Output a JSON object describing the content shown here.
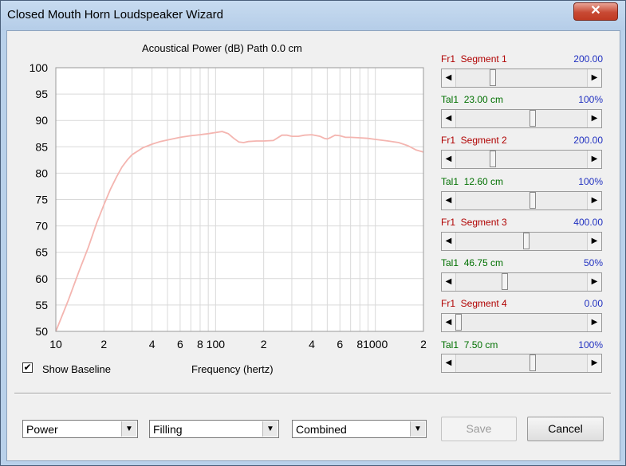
{
  "window": {
    "title": "Closed Mouth Horn Loudspeaker Wizard",
    "close_glyph": "✕"
  },
  "plot": {
    "title": "Acoustical Power (dB)   Path 0.0 cm",
    "xlabel": "Frequency (hertz)"
  },
  "chart_data": {
    "type": "line",
    "title": "Acoustical Power (dB)   Path 0.0 cm",
    "xlabel": "Frequency (hertz)",
    "ylabel": "",
    "x_scale": "log",
    "xlim": [
      10,
      2000
    ],
    "ylim": [
      50,
      100
    ],
    "grid": true,
    "y_ticks": [
      100,
      95,
      90,
      85,
      80,
      75,
      70,
      65,
      60,
      55,
      50
    ],
    "x_tick_labels": [
      "10",
      "2",
      "4",
      "6",
      "8",
      "100",
      "2",
      "4",
      "6",
      "8",
      "1000",
      "2"
    ],
    "series": [
      {
        "color": "#f4b5b0",
        "x": [
          10,
          12,
          14,
          16,
          18,
          20,
          22,
          24,
          26,
          28,
          30,
          35,
          40,
          45,
          50,
          60,
          70,
          80,
          90,
          100,
          110,
          120,
          130,
          140,
          150,
          160,
          180,
          200,
          230,
          260,
          280,
          300,
          330,
          360,
          400,
          450,
          480,
          500,
          520,
          560,
          600,
          650,
          700,
          800,
          900,
          1000,
          1200,
          1400,
          1600,
          1800,
          2000
        ],
        "y": [
          50,
          56,
          61.5,
          66,
          70.5,
          74,
          77,
          79.3,
          81.2,
          82.5,
          83.5,
          84.8,
          85.5,
          86.0,
          86.3,
          86.8,
          87.1,
          87.3,
          87.5,
          87.7,
          87.9,
          87.5,
          86.6,
          85.9,
          85.8,
          86.0,
          86.1,
          86.1,
          86.2,
          87.2,
          87.2,
          87.0,
          87.0,
          87.2,
          87.3,
          87.0,
          86.6,
          86.5,
          86.7,
          87.2,
          87.1,
          86.8,
          86.8,
          86.7,
          86.6,
          86.4,
          86.1,
          85.8,
          85.2,
          84.4,
          84.0
        ]
      }
    ]
  },
  "segments": [
    {
      "fr_label": "Fr1",
      "seg_label": "Segment 1",
      "value": "200.00",
      "thumb": 0.27
    },
    {
      "tal_label": "Tal1",
      "dim": "23.00 cm",
      "pct": "100%",
      "thumb": 0.59
    },
    {
      "fr_label": "Fr1",
      "seg_label": "Segment 2",
      "value": "200.00",
      "thumb": 0.27
    },
    {
      "tal_label": "Tal1",
      "dim": "12.60 cm",
      "pct": "100%",
      "thumb": 0.59
    },
    {
      "fr_label": "Fr1",
      "seg_label": "Segment 3",
      "value": "400.00",
      "thumb": 0.54
    },
    {
      "tal_label": "Tal1",
      "dim": "46.75 cm",
      "pct": "50%",
      "thumb": 0.37
    },
    {
      "fr_label": "Fr1",
      "seg_label": "Segment 4",
      "value": "0.00",
      "thumb": 0.0
    },
    {
      "tal_label": "Tal1",
      "dim": "7.50 cm",
      "pct": "100%",
      "thumb": 0.59
    }
  ],
  "checkbox": {
    "checked": true,
    "mark": "✔",
    "label": "Show Baseline"
  },
  "selects": {
    "mode": "Power",
    "material": "Filling",
    "output": "Combined"
  },
  "buttons": {
    "save": "Save",
    "cancel": "Cancel"
  },
  "glyphs": {
    "arrow_left": "◀",
    "arrow_right": "▶",
    "dropdown": "▼"
  }
}
